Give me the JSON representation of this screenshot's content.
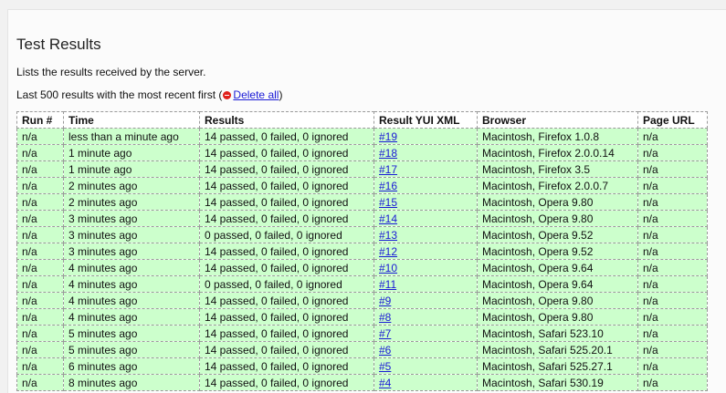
{
  "page": {
    "title": "Test Results",
    "description": "Lists the results received by the server.",
    "subtitle_prefix": "Last 500 results with the most recent first (",
    "delete_label": "Delete all",
    "subtitle_suffix": ")"
  },
  "table": {
    "headers": [
      "Run #",
      "Time",
      "Results",
      "Result YUI XML",
      "Browser",
      "Page URL"
    ],
    "rows": [
      [
        "n/a",
        "less than a minute ago",
        "14 passed, 0 failed, 0 ignored",
        "#19",
        "Macintosh, Firefox 1.0.8",
        "n/a"
      ],
      [
        "n/a",
        "1 minute ago",
        "14 passed, 0 failed, 0 ignored",
        "#18",
        "Macintosh, Firefox 2.0.0.14",
        "n/a"
      ],
      [
        "n/a",
        "1 minute ago",
        "14 passed, 0 failed, 0 ignored",
        "#17",
        "Macintosh, Firefox 3.5",
        "n/a"
      ],
      [
        "n/a",
        "2 minutes ago",
        "14 passed, 0 failed, 0 ignored",
        "#16",
        "Macintosh, Firefox 2.0.0.7",
        "n/a"
      ],
      [
        "n/a",
        "2 minutes ago",
        "14 passed, 0 failed, 0 ignored",
        "#15",
        "Macintosh, Opera 9.80",
        "n/a"
      ],
      [
        "n/a",
        "3 minutes ago",
        "14 passed, 0 failed, 0 ignored",
        "#14",
        "Macintosh, Opera 9.80",
        "n/a"
      ],
      [
        "n/a",
        "3 minutes ago",
        "0 passed, 0 failed, 0 ignored",
        "#13",
        "Macintosh, Opera 9.52",
        "n/a"
      ],
      [
        "n/a",
        "3 minutes ago",
        "14 passed, 0 failed, 0 ignored",
        "#12",
        "Macintosh, Opera 9.52",
        "n/a"
      ],
      [
        "n/a",
        "4 minutes ago",
        "14 passed, 0 failed, 0 ignored",
        "#10",
        "Macintosh, Opera 9.64",
        "n/a"
      ],
      [
        "n/a",
        "4 minutes ago",
        "0 passed, 0 failed, 0 ignored",
        "#11",
        "Macintosh, Opera 9.64",
        "n/a"
      ],
      [
        "n/a",
        "4 minutes ago",
        "14 passed, 0 failed, 0 ignored",
        "#9",
        "Macintosh, Opera 9.80",
        "n/a"
      ],
      [
        "n/a",
        "4 minutes ago",
        "14 passed, 0 failed, 0 ignored",
        "#8",
        "Macintosh, Opera 9.80",
        "n/a"
      ],
      [
        "n/a",
        "5 minutes ago",
        "14 passed, 0 failed, 0 ignored",
        "#7",
        "Macintosh, Safari 523.10",
        "n/a"
      ],
      [
        "n/a",
        "5 minutes ago",
        "14 passed, 0 failed, 0 ignored",
        "#6",
        "Macintosh, Safari 525.20.1",
        "n/a"
      ],
      [
        "n/a",
        "6 minutes ago",
        "14 passed, 0 failed, 0 ignored",
        "#5",
        "Macintosh, Safari 525.27.1",
        "n/a"
      ],
      [
        "n/a",
        "8 minutes ago",
        "14 passed, 0 failed, 0 ignored",
        "#4",
        "Macintosh, Safari 530.19",
        "n/a"
      ]
    ]
  },
  "colors": {
    "row_background": "#ccffcc",
    "link": "#1a1ad6",
    "delete_icon": "#e0201b"
  },
  "icons": {
    "delete": "delete-icon"
  }
}
